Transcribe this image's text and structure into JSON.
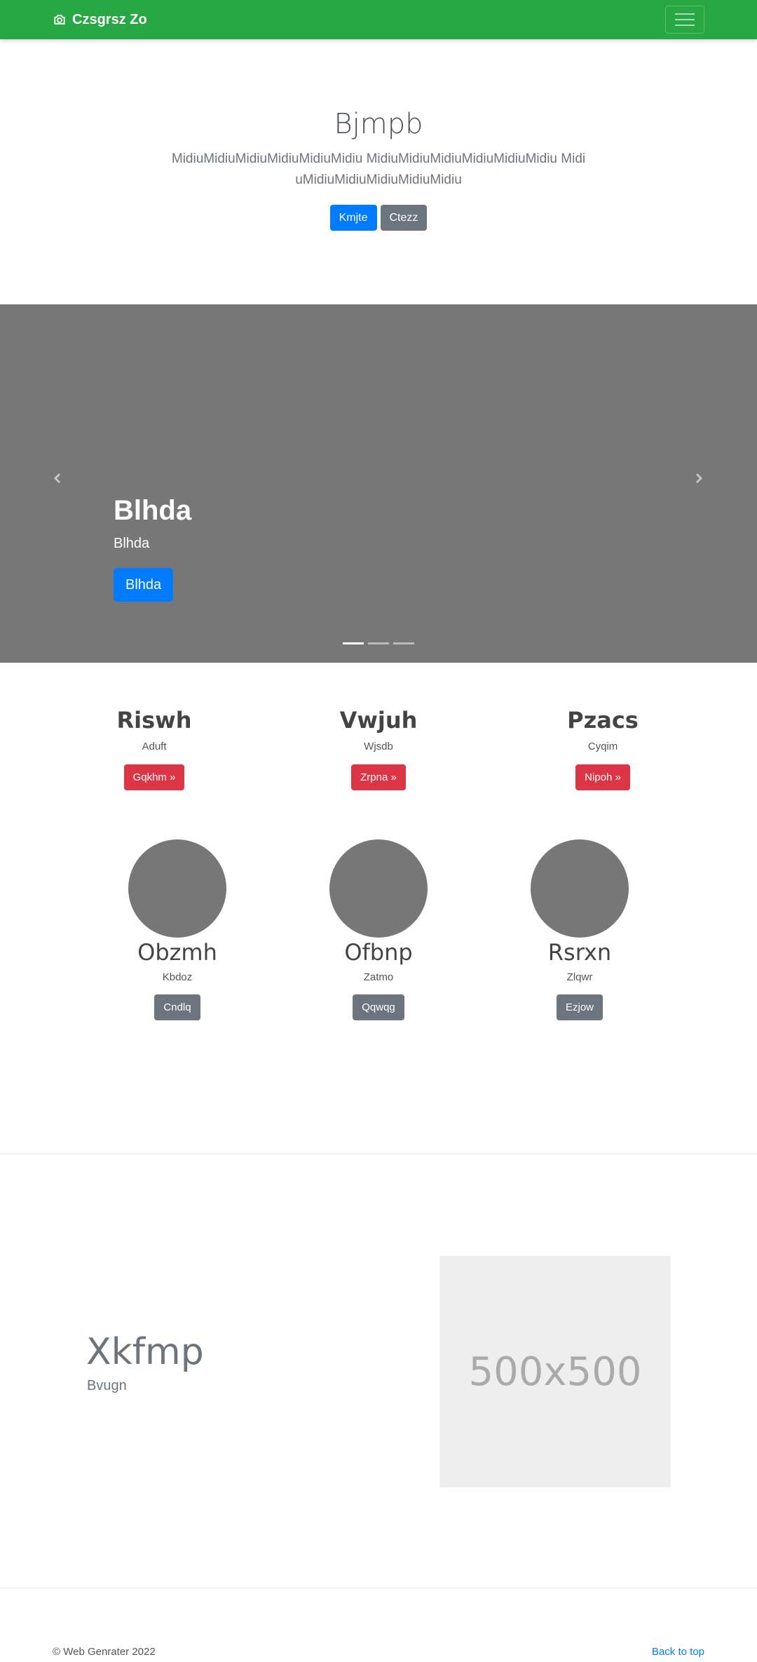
{
  "navbar": {
    "brand": "Czsgrsz Zo",
    "brand_icon": "camera-icon",
    "menu_icon": "hamburger-icon",
    "color": "#28a745"
  },
  "jumbotron": {
    "title": "Bjmpb",
    "lead": "MidiuMidiuMidiuMidiuMidiuMidiu MidiuMidiuMidiuMidiuMidiuMidiu MidiuMidiuMidiuMidiuMidiuMidiu",
    "primary_button": "Kmjte",
    "secondary_button": "Ctezz"
  },
  "carousel": {
    "title": "Blhda",
    "subtitle": "Blhda",
    "button": "Blhda",
    "slide_count": 3,
    "active_slide": 1
  },
  "features": [
    {
      "title": "Riswh",
      "text": "Aduft",
      "button": "Gqkhm »"
    },
    {
      "title": "Vwjuh",
      "text": "Wjsdb",
      "button": "Zrpna »"
    },
    {
      "title": "Pzacs",
      "text": "Cyqim",
      "button": "Nipoh »"
    }
  ],
  "circles": [
    {
      "title": "Obzmh",
      "text": "Kbdoz",
      "button": "Cndlq"
    },
    {
      "title": "Ofbnp",
      "text": "Zatmo",
      "button": "Qqwqg"
    },
    {
      "title": "Rsrxn",
      "text": "Zlqwr",
      "button": "Ezjow"
    }
  ],
  "featurette": {
    "title": "Xkfmp",
    "subtitle": "Bvugn",
    "placeholder": "500x500"
  },
  "footer": {
    "copyright": "© Web Genrater 2022",
    "back_to_top": "Back to top"
  }
}
